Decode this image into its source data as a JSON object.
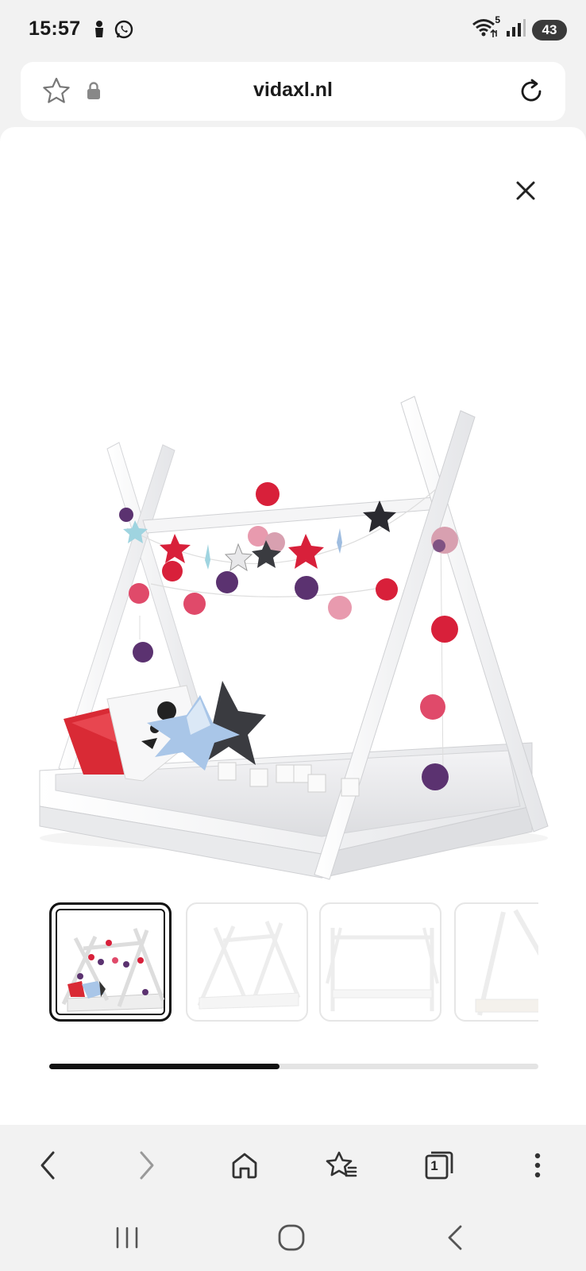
{
  "status_bar": {
    "time": "15:57",
    "wifi_label": "5",
    "battery": "43",
    "icons": [
      "notification-person-icon",
      "whatsapp-icon",
      "wifi-icon",
      "signal-icon",
      "battery-icon"
    ]
  },
  "browser": {
    "url": "vidaxl.nl",
    "icons": [
      "bookmark-star-icon",
      "lock-icon",
      "reload-icon"
    ]
  },
  "gallery": {
    "image_alt": "Kinderbed tipi wit",
    "thumbnail_count": 4,
    "active_thumbnail_index": 0,
    "scroll_progress": 0.47,
    "icons": [
      "close-icon"
    ]
  },
  "bottom_nav": {
    "tab_count": "1",
    "icons": [
      "back-icon",
      "forward-icon",
      "home-icon",
      "favorites-icon",
      "tabs-icon",
      "more-icon"
    ]
  },
  "system_nav": {
    "icons": [
      "recents-icon",
      "home-circle-icon",
      "system-back-icon"
    ]
  },
  "colors": {
    "background": "#f2f2f2",
    "sheet": "#ffffff",
    "accent_dark": "#111111",
    "ball_red": "#d8203a",
    "ball_purple": "#5b3270",
    "pillow_red": "#d92a35",
    "pillow_blue": "#a9c6e8"
  }
}
